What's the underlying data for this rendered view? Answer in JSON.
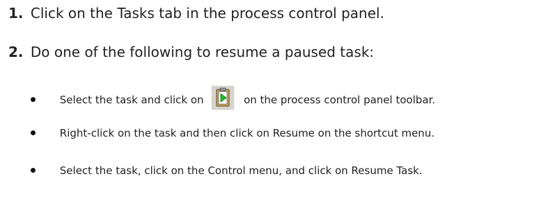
{
  "steps": [
    {
      "number": "1.",
      "text": "Click on the Tasks tab in the process control panel."
    },
    {
      "number": "2.",
      "text": "Do one of the following to resume a paused task:"
    }
  ],
  "bullets": [
    {
      "before_icon": "Select the task and click on",
      "icon": "resume-task-icon",
      "after_icon": "on the process control panel toolbar."
    },
    {
      "text": "Right-click on the task and then click on Resume on the shortcut menu."
    },
    {
      "text": "Select the task, click on the Control menu, and click on Resume Task."
    }
  ],
  "colors": {
    "text": "#222222",
    "icon_background": "#d6d3ce",
    "icon_clipboard": "#c9a25a",
    "icon_play": "#1fbf2a"
  }
}
